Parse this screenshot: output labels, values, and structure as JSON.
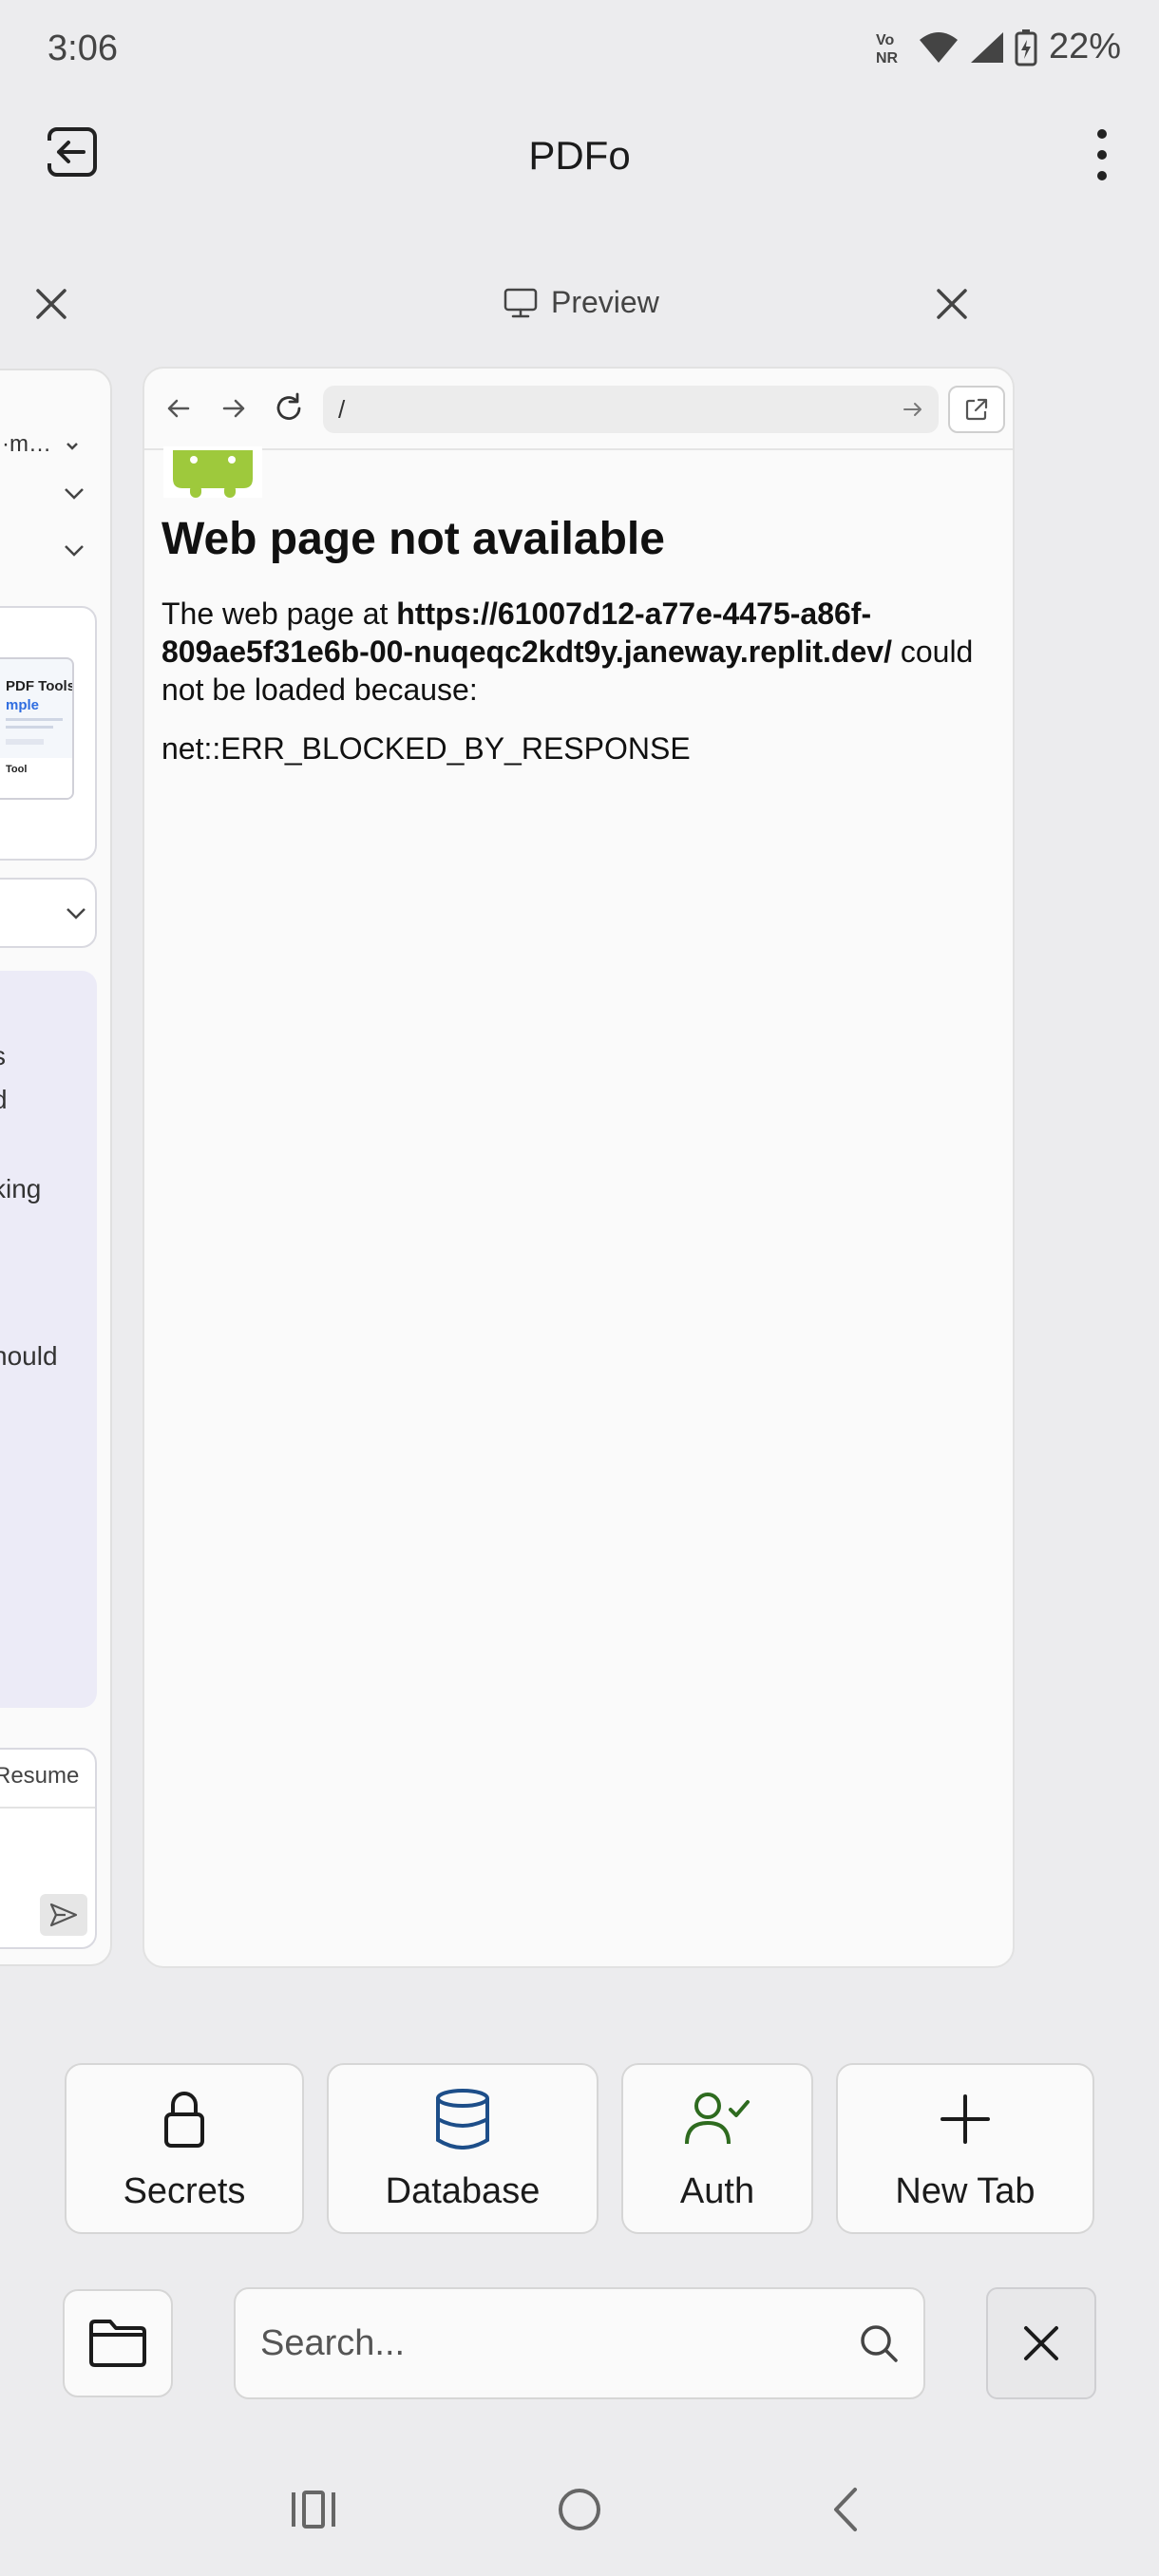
{
  "status_bar": {
    "time": "3:06",
    "network": "Vo NR",
    "battery": "22%"
  },
  "app_bar": {
    "title": "PDFo"
  },
  "tab_header": {
    "active_tab": "Preview"
  },
  "left_panel": {
    "row1": "·m…",
    "card_title": "PDF Tools",
    "card_subtitle": "mple",
    "card_section": "Tool",
    "chat_lines": [
      "s",
      "d",
      "king",
      "hould"
    ],
    "composer_label": "Resume",
    "composer_icon": "l"
  },
  "preview": {
    "url": "/",
    "heading": "Web page not available",
    "message_prefix": "The web page at ",
    "url_text": "https://61007d12-a77e-4475-a86f-809ae5f31e6b-00-nuqeqc2kdt9y.janeway.replit.dev/",
    "message_suffix": " could not be loaded because:",
    "error_code": "net::ERR_BLOCKED_BY_RESPONSE"
  },
  "quick_actions": [
    {
      "label": "Secrets",
      "icon": "lock-icon"
    },
    {
      "label": "Database",
      "icon": "database-icon"
    },
    {
      "label": "Auth",
      "icon": "user-check-icon"
    },
    {
      "label": "New Tab",
      "icon": "plus-icon"
    }
  ],
  "search": {
    "placeholder": "Search..."
  },
  "colors": {
    "database_blue": "#1d4e89",
    "auth_green": "#2e6b1f",
    "android_green": "#9ec93c"
  }
}
